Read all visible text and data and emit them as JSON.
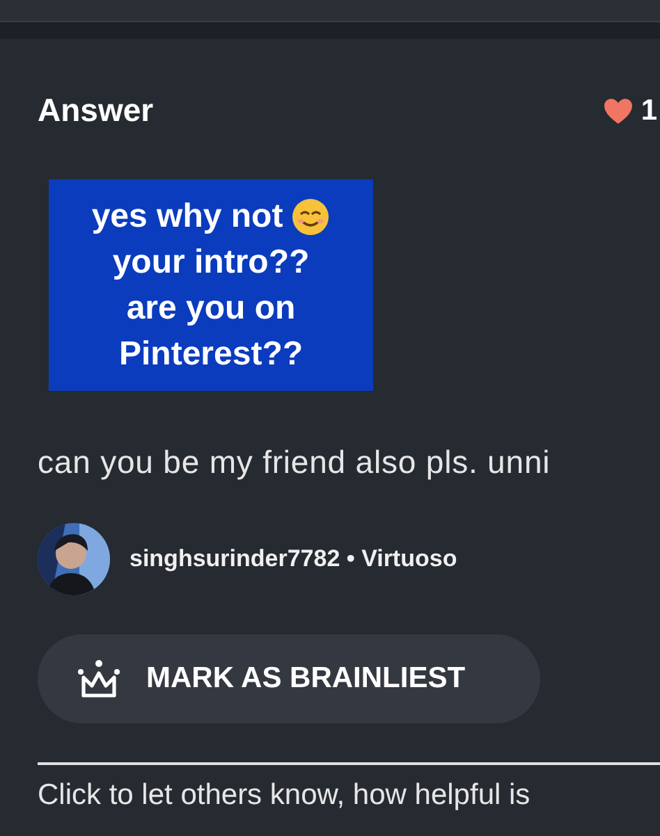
{
  "header": {
    "title": "Answer",
    "likes": "1"
  },
  "answer": {
    "sticker": {
      "lines": [
        "yes why not",
        "your intro??",
        "are you on",
        "Pinterest??"
      ]
    },
    "text": "can you be my friend also pls. unni"
  },
  "author": {
    "kind": "picture",
    "name": "singhsurinder7782 • Virtuoso"
  },
  "brainliest_button": {
    "label": "MARK AS BRAINLIEST"
  },
  "footer": {
    "text": "Click to let others know, how helpful is"
  }
}
